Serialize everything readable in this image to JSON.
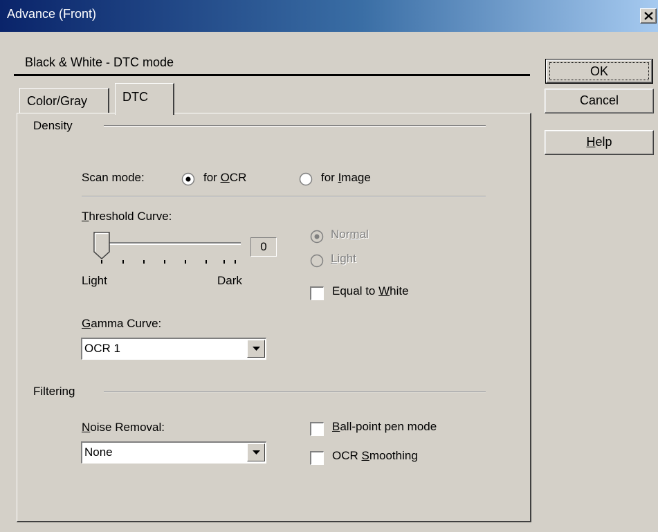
{
  "window": {
    "title": "Advance (Front)",
    "close_icon": "close-icon"
  },
  "header": {
    "mode_label": "Black & White - DTC mode"
  },
  "buttons": {
    "ok": "OK",
    "cancel": "Cancel",
    "help": "Help"
  },
  "tabs": [
    {
      "label": "Color/Gray",
      "selected": false
    },
    {
      "label": "DTC",
      "selected": true
    }
  ],
  "density": {
    "group_label": "Density",
    "scan_mode": {
      "label": "Scan mode:",
      "options": [
        {
          "label": "for OCR",
          "selected": true
        },
        {
          "label": "for Image",
          "selected": false
        }
      ]
    },
    "threshold": {
      "label": "Threshold Curve:",
      "value": "0",
      "min_label": "Light",
      "max_label": "Dark",
      "level": 0,
      "tick_count": 8
    },
    "curve_type": {
      "enabled": false,
      "options": [
        {
          "label": "Normal",
          "selected": true
        },
        {
          "label": "Light",
          "selected": false
        }
      ]
    },
    "equal_to_white": {
      "label": "Equal to White",
      "checked": false
    },
    "gamma": {
      "label": "Gamma Curve:",
      "value": "OCR 1"
    }
  },
  "filtering": {
    "group_label": "Filtering",
    "noise_removal": {
      "label": "Noise Removal:",
      "value": "None"
    },
    "ballpoint": {
      "label": "Ball-point pen mode",
      "checked": false
    },
    "ocr_smoothing": {
      "label": "OCR Smoothing",
      "checked": false
    }
  },
  "colors": {
    "face": "#d4d0c8",
    "title_start": "#0a246a",
    "title_end": "#a6caf0",
    "shadow": "#808080",
    "disabled_text": "#808080"
  }
}
